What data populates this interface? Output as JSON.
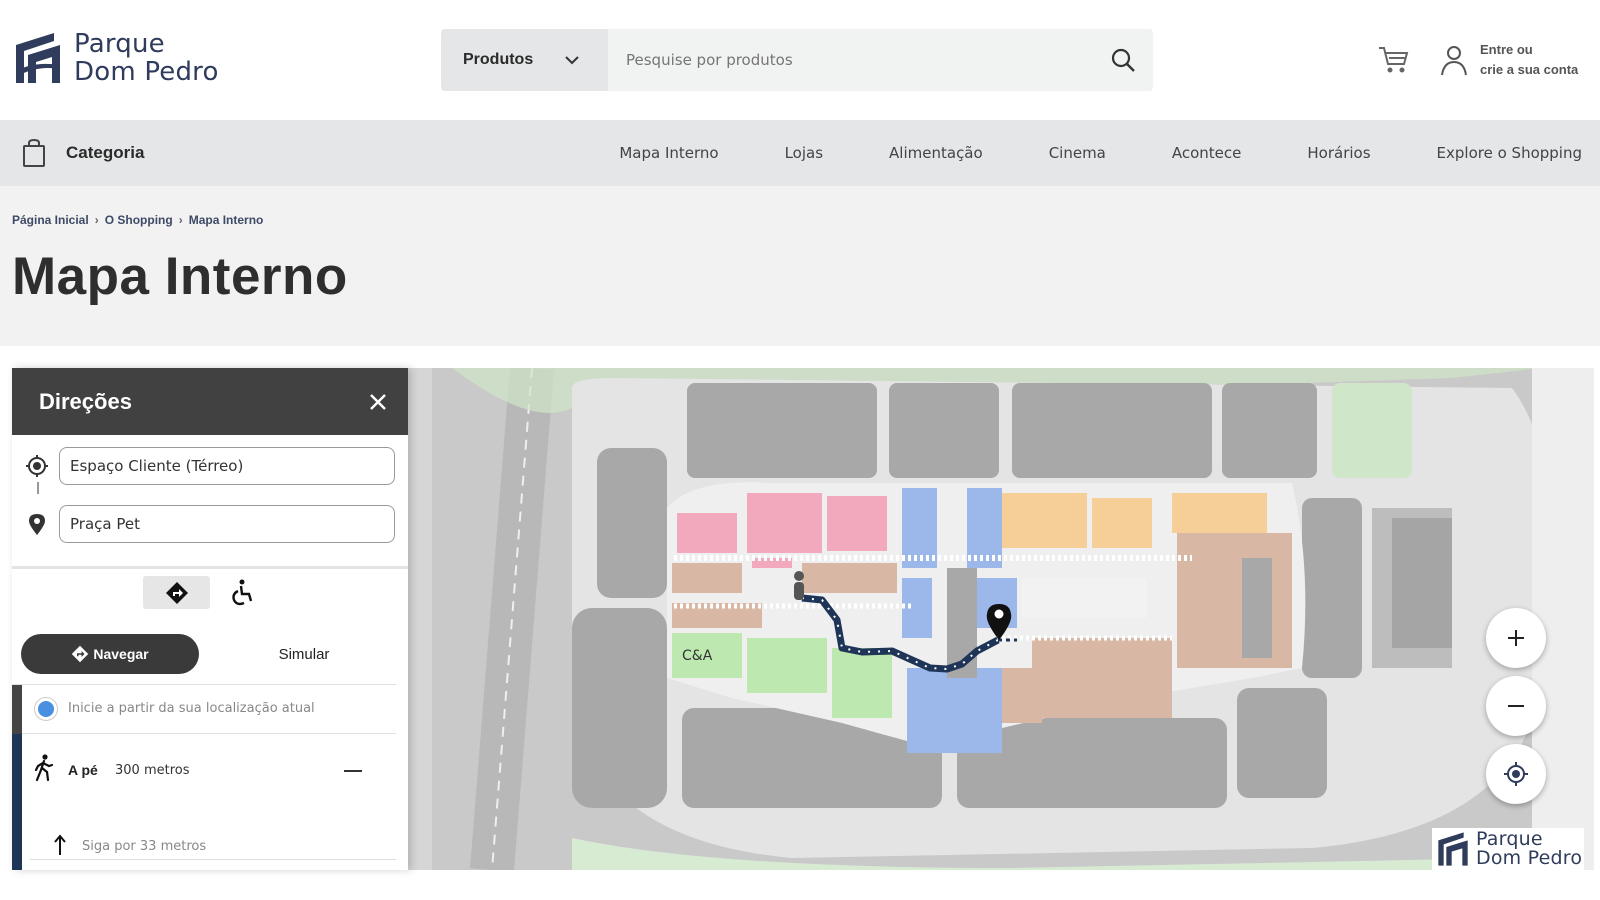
{
  "brand": {
    "line1": "Parque",
    "line2": "Dom Pedro"
  },
  "search": {
    "category_label": "Produtos",
    "placeholder": "Pesquise por produtos"
  },
  "account": {
    "line1": "Entre ou",
    "line2": "crie a sua conta"
  },
  "nav": {
    "category_label": "Categoria",
    "links": [
      "Mapa Interno",
      "Lojas",
      "Alimentação",
      "Cinema",
      "Acontece",
      "Horários",
      "Explore o Shopping"
    ]
  },
  "breadcrumb": [
    "Página Inicial",
    "O Shopping",
    "Mapa Interno"
  ],
  "page_title": "Mapa Interno",
  "directions": {
    "title": "Direções",
    "origin": "Espaço Cliente (Térreo)",
    "destination": "Praça Pet",
    "navigate_label": "Navegar",
    "simulate_label": "Simular",
    "current_location_label": "Inicie a partir da sua localização atual",
    "mode_label": "A pé",
    "distance": "300 metros",
    "step_text": "Siga por 33 metros"
  },
  "map": {
    "store_label": "C&A",
    "zoom_in": "+",
    "zoom_out": "−",
    "colors": {
      "pink": "#f2a9bd",
      "blue": "#9cb8ea",
      "orange": "#f6cf98",
      "tan": "#d8b8a4",
      "green": "#bde8b0",
      "route": "#1f3558"
    }
  },
  "icons": [
    "chevron-down-icon",
    "search-icon",
    "cart-icon",
    "user-icon",
    "bag-icon",
    "close-icon",
    "target-icon",
    "pin-icon",
    "directions-icon",
    "wheelchair-icon",
    "walk-icon",
    "arrow-up-icon",
    "locate-icon",
    "plus-icon",
    "minus-icon"
  ]
}
